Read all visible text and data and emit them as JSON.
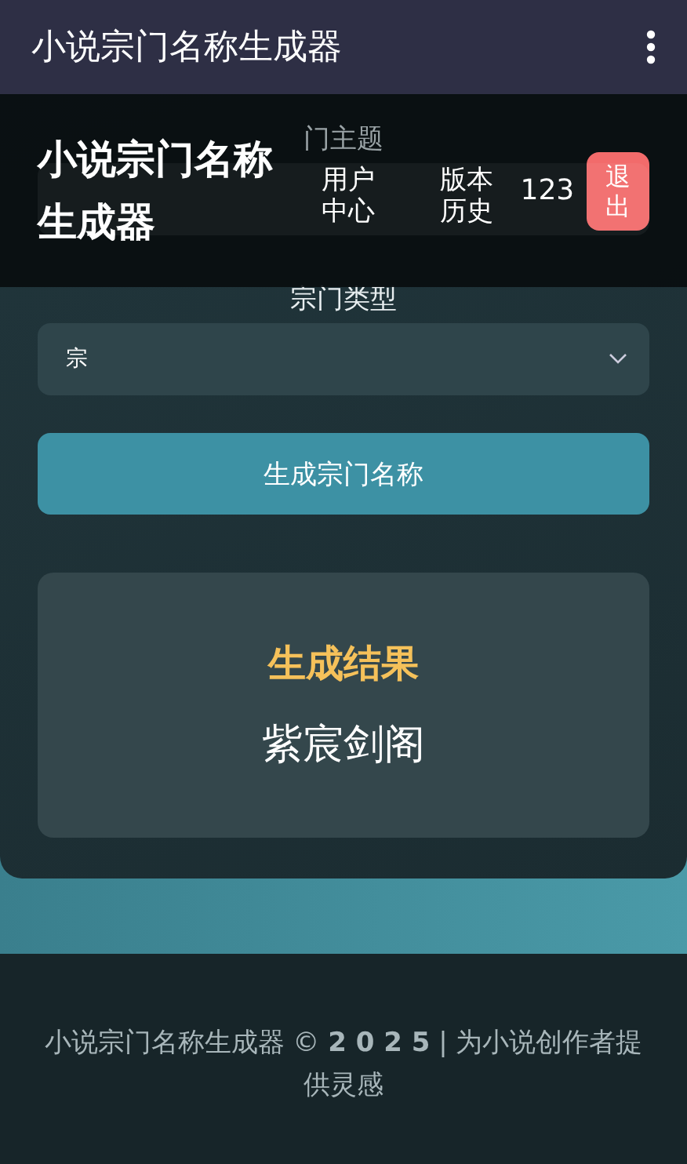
{
  "app_bar": {
    "title": "小说宗门名称生成器"
  },
  "overlay_header": {
    "title": "小说宗门名称生成器",
    "nav": [
      {
        "label": "用户中心",
        "kind": "link"
      },
      {
        "label": "版本历史",
        "kind": "link"
      },
      {
        "label": "123",
        "kind": "text"
      }
    ],
    "logout": "退出"
  },
  "form": {
    "fields": [
      {
        "label": "门主题",
        "kind": "input"
      },
      {
        "label": "宗门类型",
        "value": "宗",
        "kind": "select"
      }
    ],
    "submit": "生成宗门名称"
  },
  "result": {
    "title": "生成结果",
    "name": "紫宸剑阁"
  },
  "footer": {
    "text": "小说宗门名称生成器 © **2 0 2 5** | 为小说创作者提供灵感"
  }
}
